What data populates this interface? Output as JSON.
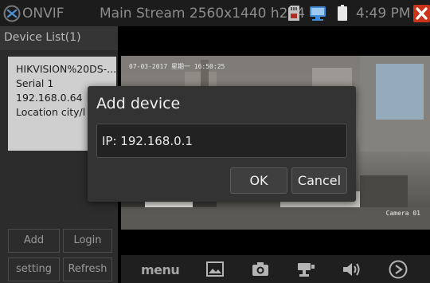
{
  "titlebar": {
    "app_name": "ONVIF",
    "stream_info": "Main Stream 2560x1440 h264",
    "time": "4:49 PM",
    "icons": [
      "onvif-logo-icon",
      "sd-card-icon",
      "network-icon",
      "battery-icon",
      "close-icon"
    ]
  },
  "sidebar": {
    "header": "Device List(1)",
    "device": {
      "name": "HIKVISION%20DS-...",
      "serial": "Serial 1",
      "ip": "192.168.0.64",
      "location": "Location city/l"
    },
    "buttons": {
      "add": "Add",
      "login": "Login",
      "setting": "setting",
      "refresh": "Refresh"
    }
  },
  "video": {
    "timestamp": "07-03-2017 星期一 16:50:25",
    "camera": "Camera 01"
  },
  "bottom_bar": {
    "menu": "menu",
    "icons": [
      "image-icon",
      "camera-icon",
      "ptz-icon",
      "volume-icon",
      "play-icon"
    ]
  },
  "dialog": {
    "title": "Add device",
    "ip_value": "IP: 192.168.0.1",
    "ok": "OK",
    "cancel": "Cancel"
  },
  "colors": {
    "close_red": "#c9341a",
    "sidebar_bg": "#2c2c2c",
    "dialog_bg": "#333333",
    "card_bg": "#cfcfcf"
  }
}
